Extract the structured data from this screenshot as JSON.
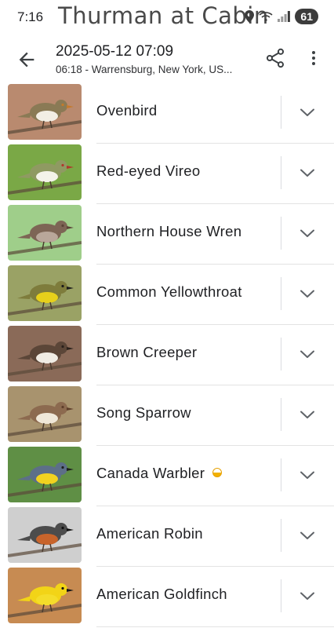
{
  "status": {
    "time": "7:16",
    "overlay_title": "Thurman at Cabin",
    "battery": "61"
  },
  "header": {
    "date": "2025-05-12 07:09",
    "subtitle": "06:18 - Warrensburg, New York, US..."
  },
  "birds": [
    {
      "name": "Ovenbird",
      "bg": "#b98a6f",
      "body": "#8a7a55",
      "belly": "#f2eee4",
      "accent": "#c47a2a"
    },
    {
      "name": "Red-eyed Vireo",
      "bg": "#7aa846",
      "body": "#8f9a62",
      "belly": "#f4f3ea",
      "accent": "#b0382c"
    },
    {
      "name": "Northern House Wren",
      "bg": "#9fce8a",
      "body": "#7d6555",
      "belly": "#b9a79a",
      "accent": "#5a4336"
    },
    {
      "name": "Common Yellowthroat",
      "bg": "#9aa265",
      "body": "#7e7c3c",
      "belly": "#e7d01b",
      "accent": "#1b1b1b"
    },
    {
      "name": "Brown Creeper",
      "bg": "#8a6a58",
      "body": "#5b4638",
      "belly": "#f0ece4",
      "accent": "#2a211b"
    },
    {
      "name": "Song Sparrow",
      "bg": "#a8936e",
      "body": "#8c6a4f",
      "belly": "#efe7d8",
      "accent": "#5e3e2a"
    },
    {
      "name": "Canada Warbler",
      "bg": "#5f8f45",
      "body": "#5d6f88",
      "belly": "#f2d21f",
      "accent": "#1e1e1e",
      "badge": "half-circle-badge"
    },
    {
      "name": "American Robin",
      "bg": "#cfcfcf",
      "body": "#4c4c4c",
      "belly": "#c8642b",
      "accent": "#111111"
    },
    {
      "name": "American Goldfinch",
      "bg": "#c78b52",
      "body": "#f2d417",
      "belly": "#f4dd2a",
      "accent": "#151515"
    }
  ]
}
